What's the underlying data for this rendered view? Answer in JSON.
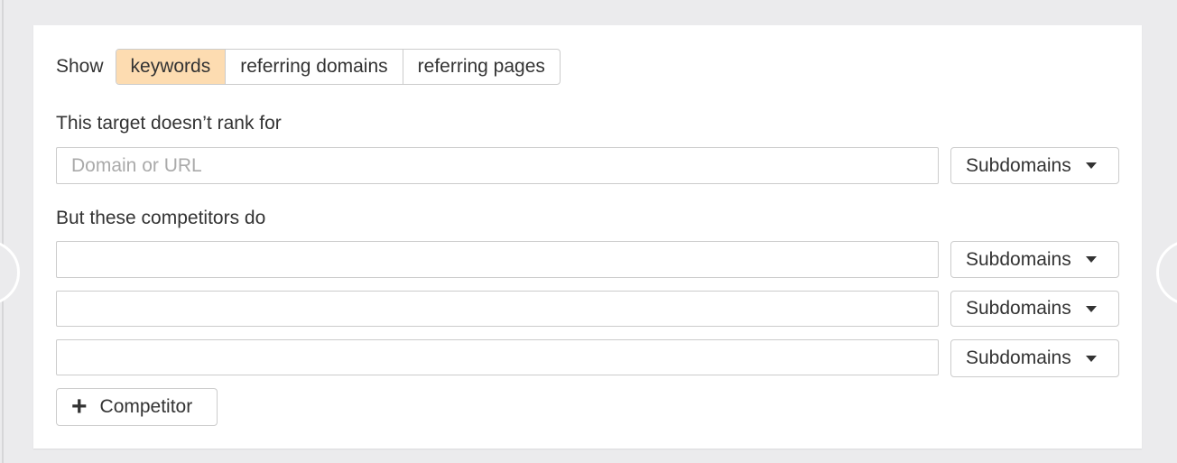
{
  "show": {
    "label": "Show",
    "tabs": [
      {
        "label": "keywords",
        "active": true
      },
      {
        "label": "referring domains",
        "active": false
      },
      {
        "label": "referring pages",
        "active": false
      }
    ]
  },
  "target": {
    "label": "This target doesn’t rank for",
    "placeholder": "Domain or URL",
    "value": "",
    "mode": "Subdomains"
  },
  "competitors": {
    "label": "But these competitors do",
    "rows": [
      {
        "value": "",
        "mode": "Subdomains"
      },
      {
        "value": "",
        "mode": "Subdomains"
      },
      {
        "value": "",
        "mode": "Subdomains"
      }
    ]
  },
  "add_button": {
    "icon": "plus-icon",
    "label": "Competitor"
  },
  "colors": {
    "active_tab": "#fddcb1",
    "background": "#ebebed"
  }
}
